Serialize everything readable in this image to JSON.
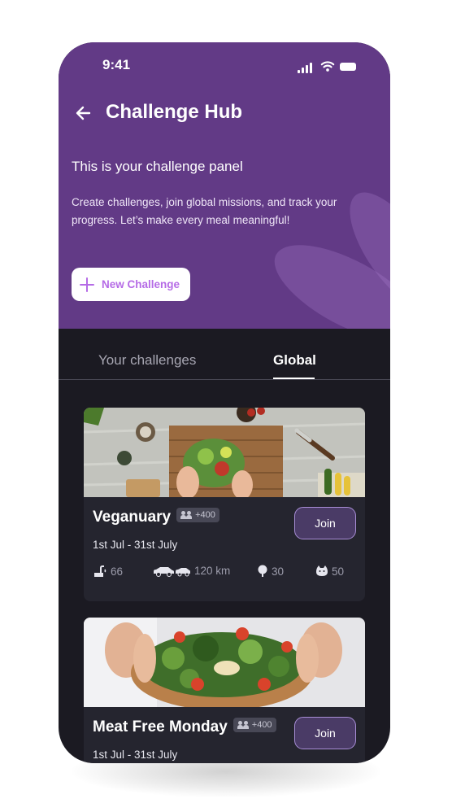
{
  "status_bar": {
    "time": "9:41"
  },
  "header": {
    "title": "Challenge Hub",
    "subtitle": "This is your challenge panel",
    "description": "Create challenges, join global missions, and track your progress. Let’s make every meal meaningful!",
    "new_button_label": "New Challenge"
  },
  "tabs": [
    {
      "label": "Your challenges",
      "active": false
    },
    {
      "label": "Global",
      "active": true
    }
  ],
  "challenges": [
    {
      "title": "Veganuary",
      "participants": "+400",
      "dates": "1st Jul - 31st July",
      "join_label": "Join",
      "stats": {
        "water": "66",
        "distance": "120 km",
        "trees": "30",
        "animals": "50"
      }
    },
    {
      "title": "Meat Free Monday",
      "participants": "+400",
      "dates": "1st Jul - 31st July",
      "join_label": "Join"
    }
  ],
  "icons": [
    "back-arrow-icon",
    "signal-icon",
    "wifi-icon",
    "battery-icon",
    "plus-icon",
    "people-icon",
    "water-icon",
    "car-icon",
    "tree-icon",
    "animal-icon"
  ],
  "colors": {
    "header": "#623a86",
    "background": "#1b1a22",
    "card": "#25252f",
    "accent": "#b56be6"
  }
}
